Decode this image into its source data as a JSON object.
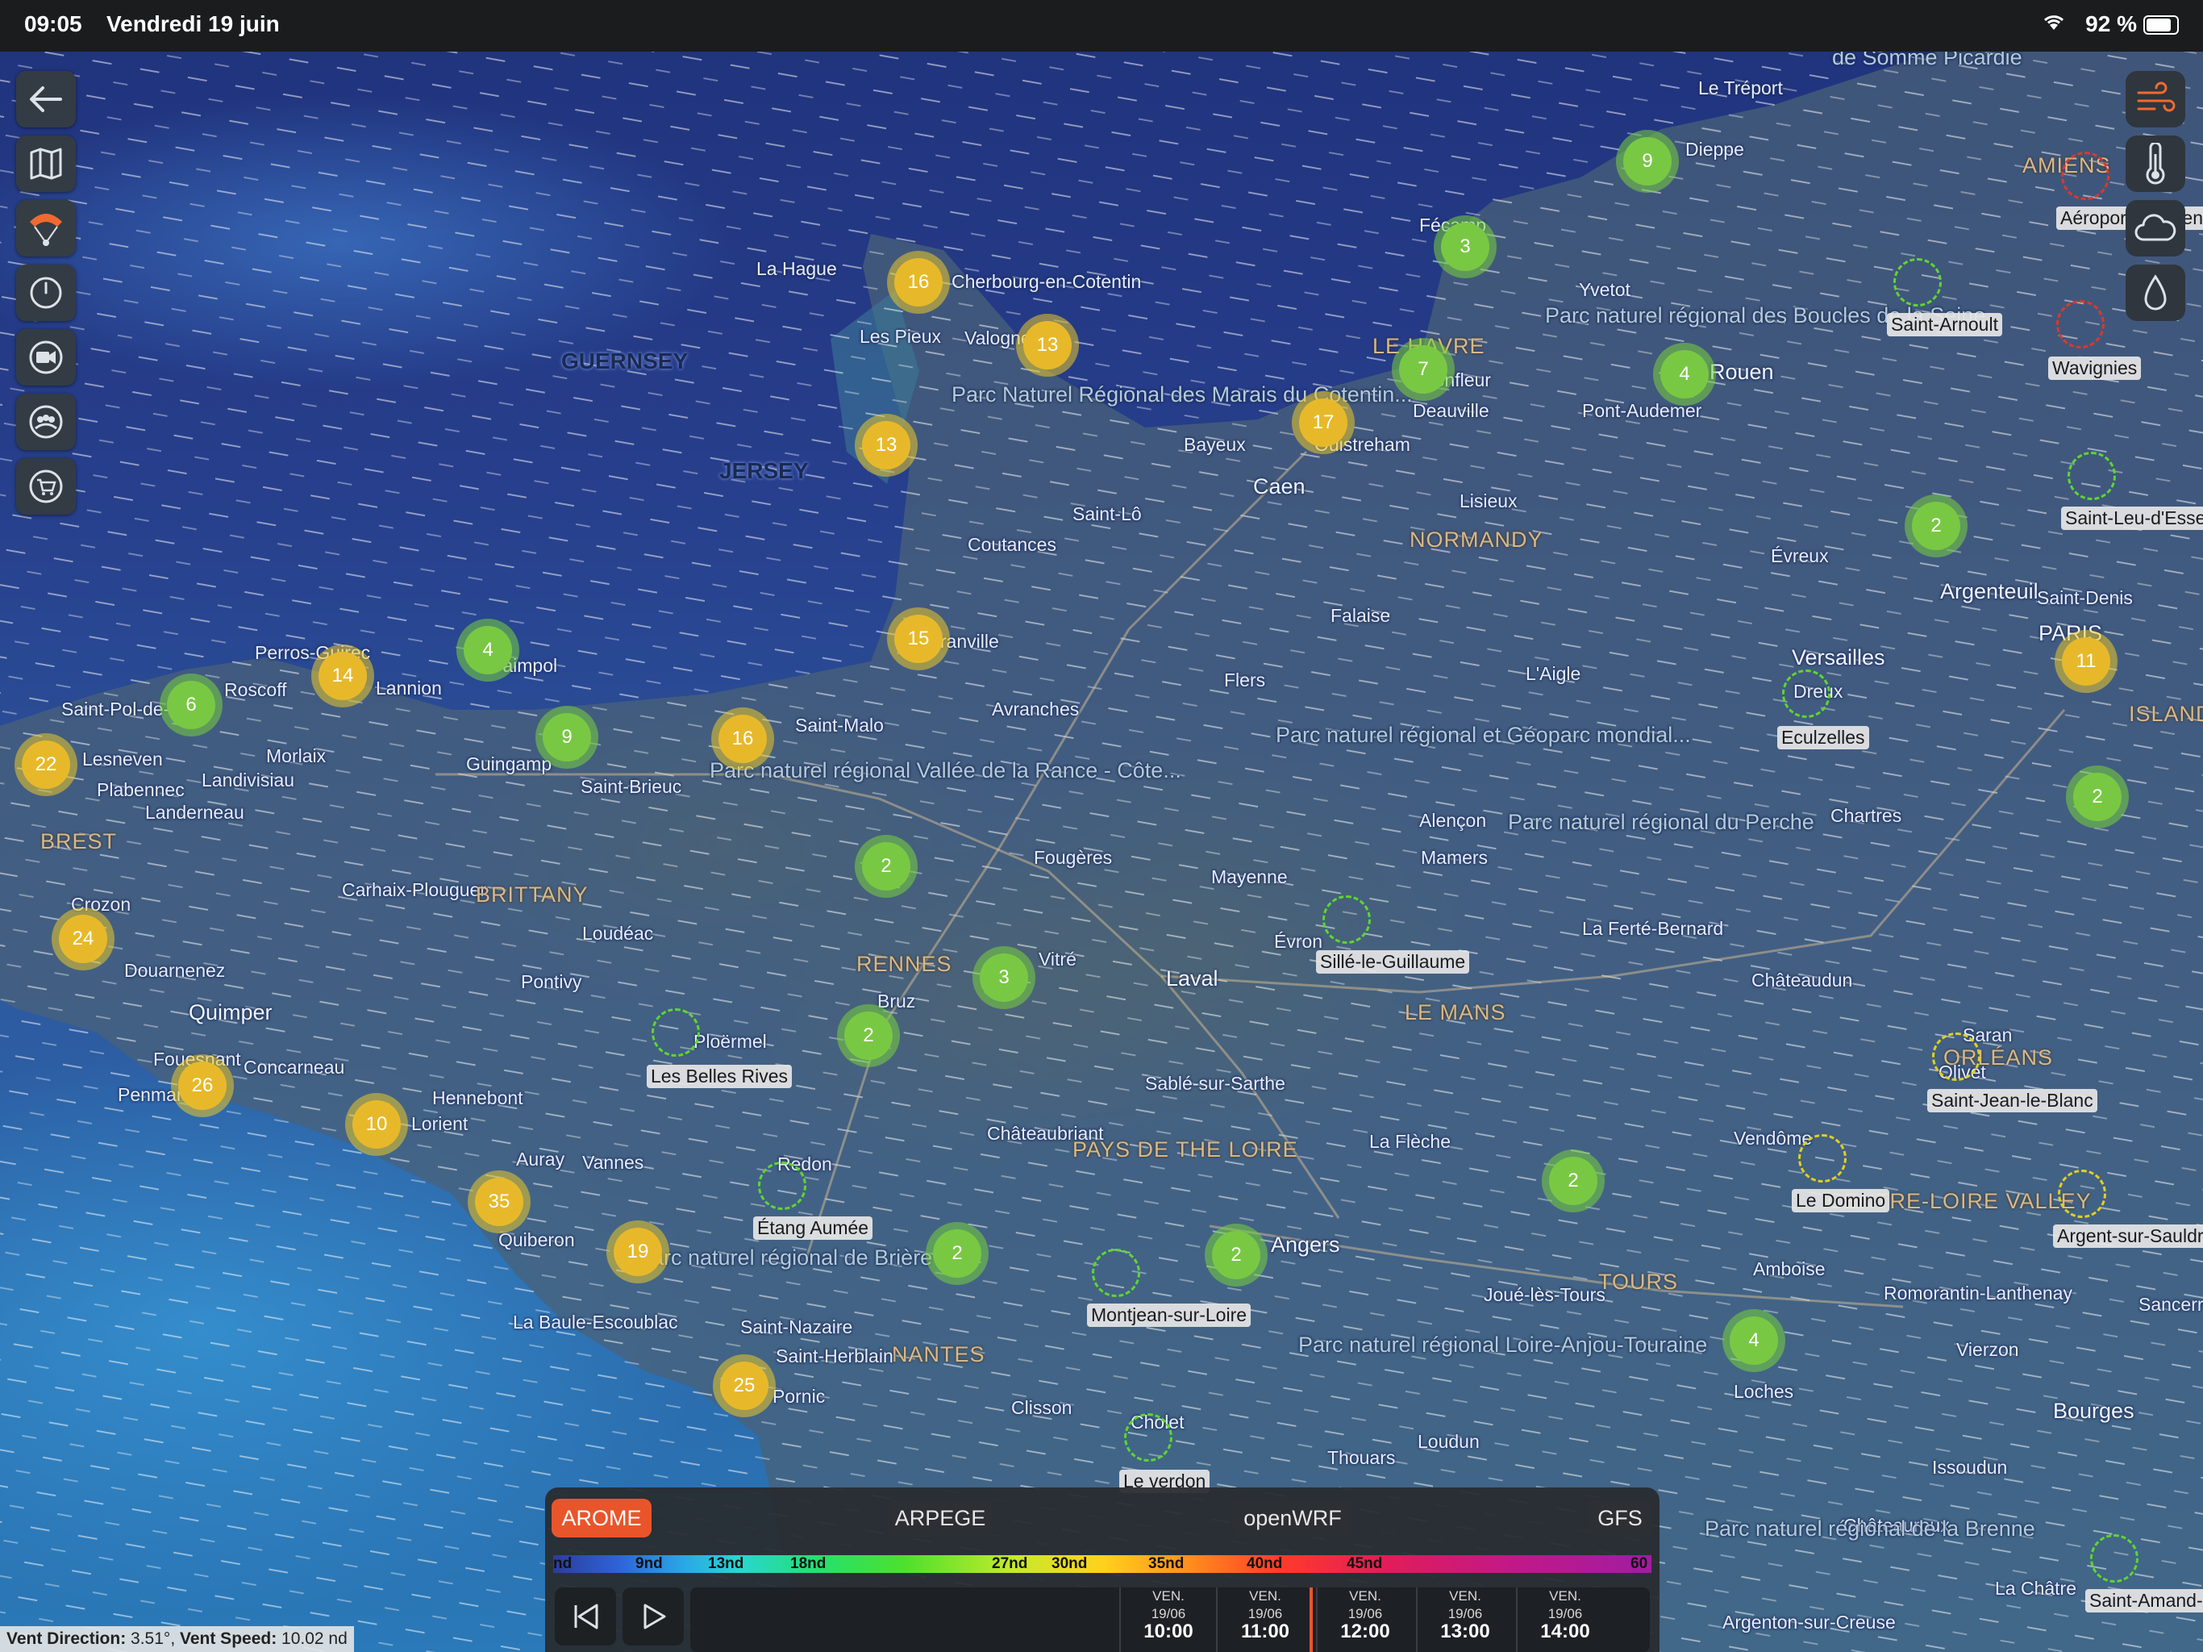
{
  "status_bar": {
    "time": "09:05",
    "date": "Vendredi 19 juin",
    "battery": "92 %"
  },
  "left_toolbar": [
    "back-icon",
    "map-icon",
    "paraglider-icon",
    "gauge-icon",
    "camera-icon",
    "community-icon",
    "cart-icon"
  ],
  "right_toolbar": [
    "wind-icon",
    "temperature-icon",
    "cloud-icon",
    "rain-icon"
  ],
  "places": {
    "cherbourg": "Cherbourg-en-Cotentin",
    "la_hague": "La Hague",
    "les_pieux": "Les Pieux",
    "valognes": "Valognes",
    "guernsey": "GUERNSEY",
    "jersey": "JERSEY",
    "pnr_cotentin": "Parc Naturel Régional des Marais du Cotentin...",
    "saint_lo": "Saint-Lô",
    "coutances": "Coutances",
    "bayeux": "Bayeux",
    "caen": "Caen",
    "ouistreham": "Ouistreham",
    "le_havre": "LE HAVRE",
    "honfleur": "Honfleur",
    "deauville": "Deauville",
    "fecamp": "Fécamp",
    "yvetot": "Yvetot",
    "dieppe": "Dieppe",
    "le_treport": "Le Tréport",
    "somme": "de Somme Picardie",
    "amiens": "AMIENS",
    "rouen": "Rouen",
    "pont_audemer": "Pont-Audemer",
    "pnr_seine": "Parc naturel régional des Boucles de la Seine",
    "lisieux": "Lisieux",
    "normandy": "NORMANDY",
    "evreux": "Évreux",
    "falaise": "Falaise",
    "granville": "Granville",
    "avranches": "Avranches",
    "flers": "Flers",
    "laigle": "L'Aigle",
    "pnr_normandie_maine": "Parc naturel régional et Géoparc mondial...",
    "alencon": "Alençon",
    "mamers": "Mamers",
    "pnr_perche": "Parc naturel régional du Perche",
    "dreux": "Dreux",
    "chartres": "Chartres",
    "versailles": "Versailles",
    "paris": "PARIS",
    "argenteuil": "Argenteuil",
    "saint_denis": "Saint-Denis",
    "ile_de_france": "ISLAND FRANCE",
    "perros": "Perros-Guirec",
    "roscoff": "Roscoff",
    "lannion": "Lannion",
    "paimpol": "Paimpol",
    "saint_pol": "Saint-Pol-de-Léon",
    "lesneven": "Lesneven",
    "morlaix": "Morlaix",
    "landivisiau": "Landivisiau",
    "plabennec": "Plabennec",
    "landerneau": "Landerneau",
    "brest": "BREST",
    "guingamp": "Guingamp",
    "saint_brieuc": "Saint-Brieuc",
    "saint_malo": "Saint-Malo",
    "pnr_rance": "Parc naturel régional Vallée de la Rance - Côte...",
    "fougeres": "Fougères",
    "mayenne": "Mayenne",
    "carhaix": "Carhaix-Plouguer",
    "brittany": "BRITTANY",
    "crozon": "Crozon",
    "douarnenez": "Douarnenez",
    "loudeac": "Loudéac",
    "rennes": "RENNES",
    "vitre": "Vitré",
    "laval": "Laval",
    "evron": "Évron",
    "bruz": "Bruz",
    "pontivy": "Pontivy",
    "quimper": "Quimper",
    "fouesnant": "Fouesnant",
    "concarneau": "Concarneau",
    "penmarch": "Penmarch",
    "hennebont": "Hennebont",
    "lorient": "Lorient",
    "ploermel": "Ploërmel",
    "auray": "Auray",
    "vannes": "Vannes",
    "quiberon": "Quiberon",
    "redon": "Redon",
    "chateaubriant": "Châteaubriant",
    "pays_de_loire": "PAYS DE THE LOIRE",
    "sable": "Sablé-sur-Sarthe",
    "le_mans": "LE MANS",
    "la_ferte": "La Ferté-Bernard",
    "la_fleche": "La Flèche",
    "chateaudun": "Châteaudun",
    "vendome": "Vendôme",
    "orleans": "ORLÉANS",
    "saran": "Saran",
    "olivet": "Olivet",
    "tours": "TOURS",
    "amboise": "Amboise",
    "loches": "Loches",
    "joue": "Joué-lès-Tours",
    "centre": "CENTRE-LOIRE VALLEY",
    "romorantin": "Romorantin-Lanthenay",
    "vierzon": "Vierzon",
    "bourges": "Bourges",
    "issoudun": "Issoudun",
    "chateauroux": "Châteauroux",
    "pnr_brenne": "Parc naturel régional de la Brenne",
    "argenton": "Argenton-sur-Creuse",
    "la_chatre": "La Châtre",
    "sancerre": "Sancerre",
    "angers": "Angers",
    "pnr_loire_anjou": "Parc naturel régional Loire-Anjou-Touraine",
    "thouars": "Thouars",
    "loudun": "Loudun",
    "cholet": "Cholet",
    "clisson": "Clisson",
    "nantes": "NANTES",
    "saint_herblain": "Saint-Herblain",
    "saint_nazaire": "Saint-Nazaire",
    "pornic": "Pornic",
    "la_baule": "La Baule-Escoublac",
    "pnr_briere": "Parc naturel régional de Brière"
  },
  "clusters": [
    {
      "value": "9",
      "color": "green"
    },
    {
      "value": "3",
      "color": "green"
    },
    {
      "value": "16",
      "color": "yellow"
    },
    {
      "value": "13",
      "color": "yellow"
    },
    {
      "value": "7",
      "color": "green"
    },
    {
      "value": "4",
      "color": "green"
    },
    {
      "value": "17",
      "color": "yellow"
    },
    {
      "value": "13",
      "color": "yellow"
    },
    {
      "value": "2",
      "color": "green"
    },
    {
      "value": "15",
      "color": "yellow"
    },
    {
      "value": "4",
      "color": "green"
    },
    {
      "value": "14",
      "color": "yellow"
    },
    {
      "value": "6",
      "color": "green"
    },
    {
      "value": "9",
      "color": "green"
    },
    {
      "value": "16",
      "color": "yellow"
    },
    {
      "value": "22",
      "color": "yellow"
    },
    {
      "value": "11",
      "color": "yellow"
    },
    {
      "value": "2",
      "color": "green"
    },
    {
      "value": "2",
      "color": "green"
    },
    {
      "value": "24",
      "color": "yellow"
    },
    {
      "value": "3",
      "color": "green"
    },
    {
      "value": "2",
      "color": "green"
    },
    {
      "value": "26",
      "color": "yellow"
    },
    {
      "value": "10",
      "color": "yellow"
    },
    {
      "value": "35",
      "color": "yellow"
    },
    {
      "value": "19",
      "color": "yellow"
    },
    {
      "value": "2",
      "color": "green"
    },
    {
      "value": "2",
      "color": "green"
    },
    {
      "value": "2",
      "color": "green"
    },
    {
      "value": "4",
      "color": "green"
    },
    {
      "value": "25",
      "color": "yellow"
    }
  ],
  "stations": [
    {
      "name": "Aéroport d'Amiens",
      "color": "red"
    },
    {
      "name": "Saint-Arnoult",
      "color": "green"
    },
    {
      "name": "Wavignies",
      "color": "red"
    },
    {
      "name": "Saint-Leu-d'Esserent",
      "color": "green"
    },
    {
      "name": "Eculzelles",
      "color": "green"
    },
    {
      "name": "Sillé-le-Guillaume",
      "color": "green"
    },
    {
      "name": "Les Belles Rives",
      "color": "green"
    },
    {
      "name": "Étang Aumée",
      "color": "green"
    },
    {
      "name": "Montjean-sur-Loire",
      "color": "green"
    },
    {
      "name": "Le Domino",
      "color": "yellow"
    },
    {
      "name": "Saint-Jean-le-Blanc",
      "color": "yellow"
    },
    {
      "name": "Argent-sur-Sauldre",
      "color": "yellow"
    },
    {
      "name": "Le verdon",
      "color": "green"
    },
    {
      "name": "Saint-Amand-Montrond",
      "color": "green"
    }
  ],
  "models": {
    "arome": "AROME",
    "arpege": "ARPEGE",
    "openwrf": "openWRF",
    "gfs": "GFS"
  },
  "scale_labels": [
    "nd",
    "9nd",
    "13nd",
    "18nd",
    "27nd",
    "30nd",
    "35nd",
    "40nd",
    "45nd",
    "60"
  ],
  "timeline": [
    {
      "day": "VEN.",
      "date": "19/06",
      "hour": "10:00"
    },
    {
      "day": "VEN.",
      "date": "19/06",
      "hour": "11:00"
    },
    {
      "day": "VEN.",
      "date": "19/06",
      "hour": "12:00"
    },
    {
      "day": "VEN.",
      "date": "19/06",
      "hour": "13:00"
    },
    {
      "day": "VEN.",
      "date": "19/06",
      "hour": "14:00"
    }
  ],
  "vent_info": {
    "direction_label": "Vent Direction:",
    "direction_value": "3.51°",
    "speed_label": "Vent Speed:",
    "speed_value": "10.02 nd"
  }
}
